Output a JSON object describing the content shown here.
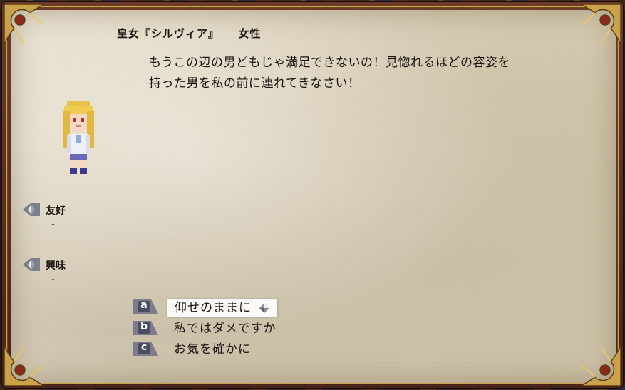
{
  "speaker": {
    "name": "皇女『シルヴィア』",
    "gender": "女性"
  },
  "dialogue": {
    "line1": "もうこの辺の男どもじゃ満足できないの！見惚れるほどの容姿を",
    "line2": "持った男を私の前に連れてきなさい！"
  },
  "portrait": {
    "icon": "blonde-princess-sprite"
  },
  "stats": {
    "affinity": {
      "label": "友好",
      "value": "-"
    },
    "interest": {
      "label": "興味",
      "value": "-"
    }
  },
  "choices": [
    {
      "key": "a",
      "label": "仰せのままに",
      "selected": true
    },
    {
      "key": "b",
      "label": "私ではダメですか",
      "selected": false
    },
    {
      "key": "c",
      "label": "お気を確かに",
      "selected": false
    }
  ],
  "colors": {
    "frame_gold": "#c9a24a",
    "frame_red": "#6e3a2a",
    "parchment": "#e2dac6",
    "text": "#1a1410",
    "key_badge": "#7c7c8c"
  }
}
